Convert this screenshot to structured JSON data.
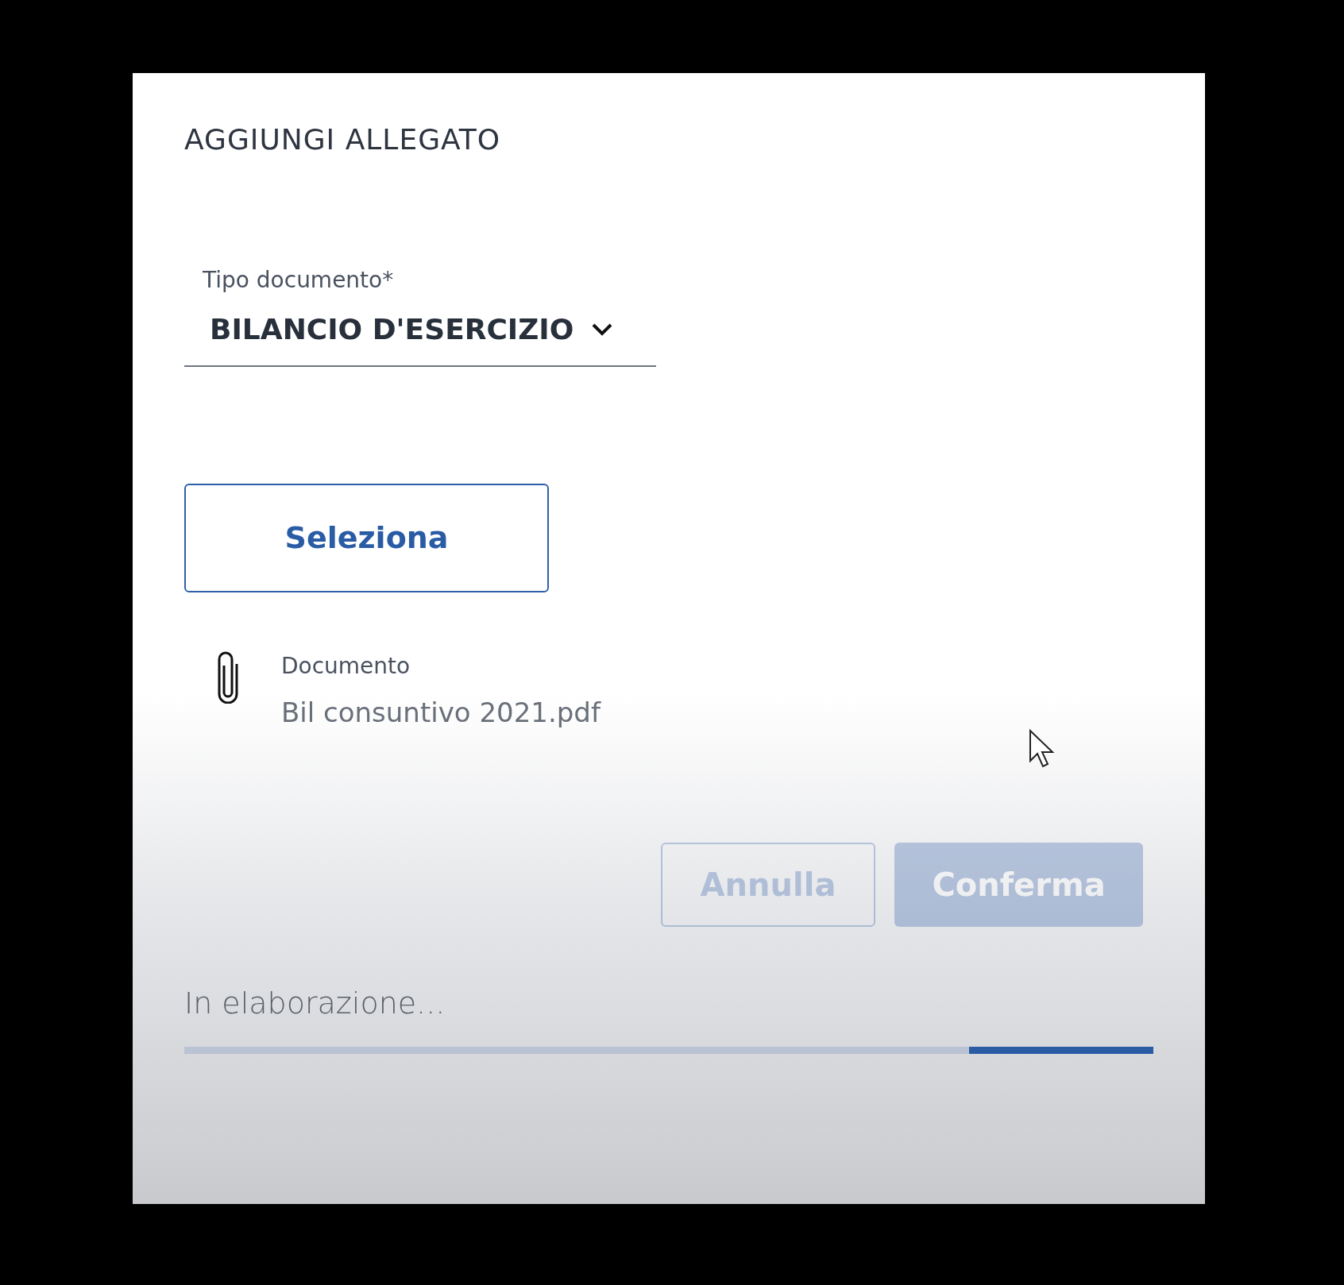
{
  "dialog": {
    "title": "AGGIUNGI ALLEGATO"
  },
  "document_type": {
    "label": "Tipo documento*",
    "value": "BILANCIO D'ESERCIZIO"
  },
  "select_button": {
    "label": "Seleziona"
  },
  "attachment": {
    "label": "Documento",
    "filename": "Bil consuntivo 2021.pdf"
  },
  "actions": [
    {
      "label": "Annulla",
      "kind": "outline",
      "disabled": true
    },
    {
      "label": "Conferma",
      "kind": "filled",
      "disabled": true
    }
  ],
  "progress": {
    "text": "In elaborazione...",
    "level": 0.19
  }
}
